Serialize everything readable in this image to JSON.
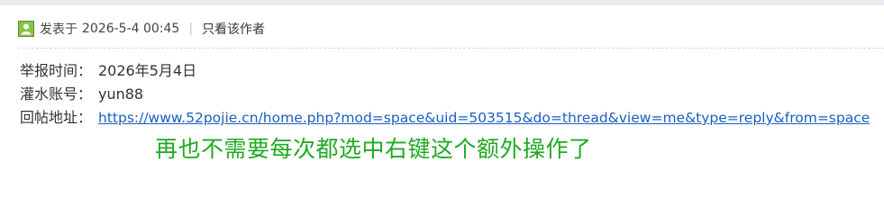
{
  "post": {
    "posted_label": "发表于",
    "posted_time": "2026-5-4 00:45",
    "separator": "|",
    "only_author_label": "只看该作者"
  },
  "report": {
    "rows": [
      {
        "label": "举报时间：",
        "value": "2026年5月4日"
      },
      {
        "label": "灌水账号：",
        "value": "yun88"
      },
      {
        "label": "回帖地址：",
        "value": "https://www.52pojie.cn/home.php?mod=space&uid=503515&do=thread&view=me&type=reply&from=space"
      }
    ]
  },
  "annotation": {
    "text": "再也不需要每次都选中右键这个额外操作了",
    "color": "#1faa22"
  },
  "icons": {
    "author": "user-icon"
  }
}
